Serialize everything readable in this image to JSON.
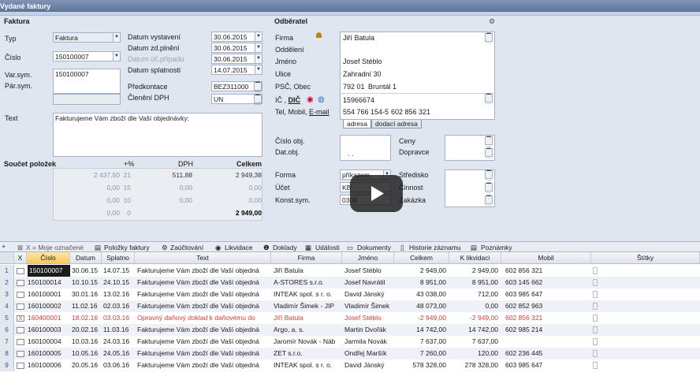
{
  "window": {
    "title": "Vydané faktury"
  },
  "faktura": {
    "heading": "Faktura",
    "typ_label": "Typ",
    "typ_value": "Faktura",
    "cislo_label": "Číslo",
    "cislo_value": "150100007",
    "varsym_label": "Var.sym.",
    "varsym_value": "150100007",
    "parsym_label": "Pár.sym.",
    "datum_vystaveni_label": "Datum vystavení",
    "datum_vystaveni": "30.06.2015",
    "datum_zdpl_label": "Datum zd.plnění",
    "datum_zdpl": "30.06.2015",
    "datum_ucp_label": "Datum úč.případu",
    "datum_ucp": "30.06.2015",
    "datum_splat_label": "Datum splatnosti",
    "datum_splat": "14.07.2015",
    "predkontace_label": "Předkontace",
    "predkontace": "BEZ311000",
    "cleneni_label": "Členění DPH",
    "cleneni": "UN",
    "text_label": "Text",
    "text_value": "Fakturujeme Vám zboží dle Vaší objednávky:"
  },
  "soucet": {
    "heading": "Součet položek",
    "col_pct": "+%",
    "col_dph": "DPH",
    "col_celkem": "Celkem",
    "rows": [
      {
        "zaklad": "2 437,50",
        "pct": "21",
        "dph": "511,88",
        "celkem": "2 949,38"
      },
      {
        "zaklad": "0,00",
        "pct": "15",
        "dph": "0,00",
        "celkem": "0,00"
      },
      {
        "zaklad": "0,00",
        "pct": "10",
        "dph": "0,00",
        "celkem": "0,00"
      },
      {
        "zaklad": "0,00",
        "pct": "0",
        "dph": "",
        "celkem": "2 949,00"
      }
    ]
  },
  "odberatel": {
    "heading": "Odběratel",
    "firma_label": "Firma",
    "firma": "Jiří Batula",
    "oddeleni_label": "Oddělení",
    "jmeno_label": "Jméno",
    "jmeno": "Josef Stéblo",
    "ulice_label": "Ulice",
    "ulice": "Zahradní 30",
    "psc_label": "PSČ, Obec",
    "psc": "792 01",
    "obec": "Bruntál 1",
    "ic_label": "IČ ,",
    "dic_label": "DIČ",
    "ic": "15966674",
    "tel_label": "Tel, Mobil,",
    "email_label": "E-mail",
    "tel": "554 766 154-5",
    "mobil": "602 856 321",
    "tab_adresa": "adresa",
    "tab_dodaci": "dodací adresa",
    "cislo_obj_label": "Číslo obj.",
    "dat_obj_label": "Dat.obj.",
    "dat_obj": ". .",
    "ceny_label": "Ceny",
    "dopravce_label": "Dopravce",
    "forma_label": "Forma",
    "forma": "příkazem",
    "ucet_label": "Účet",
    "ucet": "KB",
    "konst_label": "Konst.sym.",
    "konst": "0308",
    "stredisko_label": "Středisko",
    "cinnost_label": "Činnost",
    "zakazka_label": "Zakázka"
  },
  "toolbar": {
    "star": "*",
    "x_label": "X = Moje označené",
    "polozky": "Položky faktury",
    "zauct": "Zaúčtování",
    "likvidace": "Likvidace",
    "doklady": "Doklady",
    "udalosti": "Události",
    "dokumenty": "Dokumenty",
    "historie": "Historie záznamu",
    "poznamky": "Poznámky"
  },
  "grid": {
    "headers": {
      "x": "X",
      "cislo": "Číslo",
      "datum": "Datum",
      "splatno": "Splatno",
      "text": "Text",
      "firma": "Firma",
      "jmeno": "Jméno",
      "celkem": "Celkem",
      "likvidaci": "K likvidaci",
      "mobil": "Mobil",
      "stitky": "Štítky"
    },
    "rows": [
      {
        "n": "1",
        "cislo": "150100007",
        "datum": "30.06.15",
        "splatno": "14.07.15",
        "text": "Fakturujeme Vám zboží dle Vaší objedná",
        "firma": "Jiří Batula",
        "jmeno": "Josef Stéblo",
        "celkem": "2 949,00",
        "lik": "2 949,00",
        "mobil": "602 856 321",
        "x": ""
      },
      {
        "n": "2",
        "cislo": "150100014",
        "datum": "10.10.15",
        "splatno": "24.10.15",
        "text": "Fakturujeme Vám zboží dle Vaší objedná",
        "firma": "A-STORES s.r.o.",
        "jmeno": "Josef Navrátil",
        "celkem": "8 951,00",
        "lik": "8 951,00",
        "mobil": "603 145 662",
        "x": ""
      },
      {
        "n": "3",
        "cislo": "160100001",
        "datum": "30.01.16",
        "splatno": "13.02.16",
        "text": "Fakturujeme Vám zboží dle Vaší objedná",
        "firma": "INTEAK spol. s r. o.",
        "jmeno": "David Jánský",
        "celkem": "43 038,00",
        "lik": "712,00",
        "mobil": "603 985 647",
        "x": ""
      },
      {
        "n": "4",
        "cislo": "160100002",
        "datum": "11.02.16",
        "splatno": "02.03.16",
        "text": "Fakturujeme Vám zboží dle Vaší objedná",
        "firma": "Vladimír Šimek - JIP",
        "jmeno": "Vladimír Šimek",
        "celkem": "48 073,00",
        "lik": "0,00",
        "mobil": "602 852 963",
        "x": ""
      },
      {
        "n": "5",
        "cislo": "160400001",
        "datum": "18.02.16",
        "splatno": "03.03.16",
        "text": "Opravný daňový doklad k daňovému do",
        "firma": "Jiří Batula",
        "jmeno": "Josef Stéblo",
        "celkem": "-2 949,00",
        "lik": "-2 949,00",
        "mobil": "602 856 321",
        "x": "X"
      },
      {
        "n": "6",
        "cislo": "160100003",
        "datum": "20.02.16",
        "splatno": "11.03.16",
        "text": "Fakturujeme Vám zboží dle Vaší objedná",
        "firma": "Argo, a. s.",
        "jmeno": "Martin Dvořák",
        "celkem": "14 742,00",
        "lik": "14 742,00",
        "mobil": "602 985 214",
        "x": ""
      },
      {
        "n": "7",
        "cislo": "160100004",
        "datum": "10.03.16",
        "splatno": "24.03.16",
        "text": "Fakturujeme Vám zboží dle Vaší objedná",
        "firma": "Jaromír Novák - Náb",
        "jmeno": "Jarmila Novák",
        "celkem": "7 637,00",
        "lik": "7 637,00",
        "mobil": "",
        "x": ""
      },
      {
        "n": "8",
        "cislo": "160100005",
        "datum": "10.05.16",
        "splatno": "24.05.16",
        "text": "Fakturujeme Vám zboží dle Vaší objedná",
        "firma": "ZET s.r.o.",
        "jmeno": "Ondřej Maršík",
        "celkem": "7 260,00",
        "lik": "120,00",
        "mobil": "602 236 445",
        "x": ""
      },
      {
        "n": "9",
        "cislo": "160100006",
        "datum": "20.05.16",
        "splatno": "03.06.16",
        "text": "Fakturujeme Vám zboží dle Vaší objedná",
        "firma": "INTEAK spol. s r. o.",
        "jmeno": "David Jánský",
        "celkem": "578 328,00",
        "lik": "278 328,00",
        "mobil": "603 985 647",
        "x": ""
      }
    ]
  },
  "colors": {
    "accent": "#3553a3",
    "red": "#e03a3a",
    "selection": "#1c1c1c"
  }
}
